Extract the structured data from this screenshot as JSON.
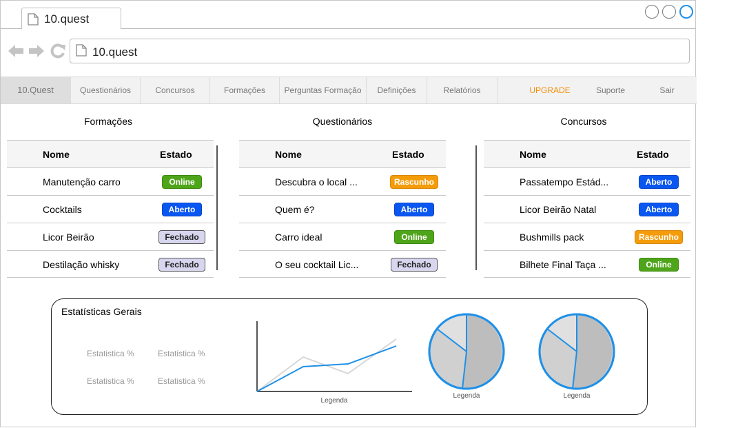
{
  "browser": {
    "tab_title": "10.quest",
    "address": "10.quest"
  },
  "menu": {
    "items": [
      {
        "label": "10.Quest"
      },
      {
        "label": "Questionários"
      },
      {
        "label": "Concursos"
      },
      {
        "label": "Formações"
      },
      {
        "label": "Perguntas Formação"
      },
      {
        "label": "Definições"
      },
      {
        "label": "Relatórios"
      },
      {
        "label": "UPGRADE"
      },
      {
        "label": "Suporte"
      },
      {
        "label": "Sair"
      }
    ],
    "upgrade_color": "#f0900c"
  },
  "formacoes": {
    "title": "Formações",
    "col_name": "Nome",
    "col_state": "Estado",
    "rows": [
      {
        "name": "Manutenção carro",
        "state": "Online"
      },
      {
        "name": "Cocktails",
        "state": "Aberto"
      },
      {
        "name": "Licor Beirão",
        "state": "Fechado"
      },
      {
        "name": "Destilação whisky",
        "state": "Fechado"
      }
    ]
  },
  "questionarios": {
    "title": "Questionários",
    "col_name": "Nome",
    "col_state": "Estado",
    "rows": [
      {
        "name": "Descubra o local ...",
        "state": "Rascunho"
      },
      {
        "name": "Quem é?",
        "state": "Aberto"
      },
      {
        "name": "Carro ideal",
        "state": "Online"
      },
      {
        "name": "O seu cocktail Lic...",
        "state": "Fechado"
      }
    ]
  },
  "concursos": {
    "title": "Concursos",
    "col_name": "Nome",
    "col_state": "Estado",
    "rows": [
      {
        "name": "Passatempo Estád...",
        "state": "Aberto"
      },
      {
        "name": "Licor Beirão Natal",
        "state": "Aberto"
      },
      {
        "name": "Bushmills pack",
        "state": "Rascunho"
      },
      {
        "name": "Bilhete Final Taça ...",
        "state": "Online"
      }
    ]
  },
  "status_colors": {
    "Online": "#4fa51a",
    "Aberto": "#0a56f0",
    "Rascunho": "#f59c0b",
    "Fechado": "#d8d6ee"
  },
  "stats": {
    "title": "Estatísticas Gerais",
    "labels": [
      "Estatistica %",
      "Estatistica %",
      "Estatistica %",
      "Estatistica %"
    ],
    "line_legend": "Legenda",
    "pie1_legend": "Legenda",
    "pie2_legend": "Legenda"
  }
}
